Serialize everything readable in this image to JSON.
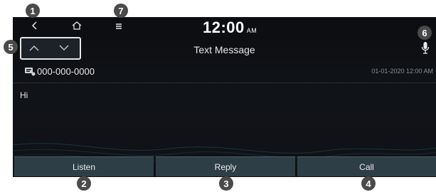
{
  "topbar": {
    "back_icon": "chevron-left-icon",
    "home_icon": "home-icon",
    "menu_icon": "menu-icon",
    "clock_time": "12:00",
    "clock_ampm": "AM"
  },
  "header": {
    "title": "Text Message",
    "prev_icon": "chevron-up-icon",
    "next_icon": "chevron-down-icon",
    "mic_icon": "microphone-icon"
  },
  "message": {
    "sender_icon": "contact-card-icon",
    "sender": "000-000-0000",
    "timestamp": "01-01-2020 12:00 AM",
    "body": "Hi"
  },
  "actions": {
    "listen_label": "Listen",
    "reply_label": "Reply",
    "call_label": "Call"
  },
  "callouts": {
    "c1": "1",
    "c2": "2",
    "c3": "3",
    "c4": "4",
    "c5": "5",
    "c6": "6",
    "c7": "7"
  },
  "colors": {
    "screen_bg": "#0f1216",
    "button_bg": "#2d3e47",
    "badge_bg": "#4a4a4a"
  }
}
